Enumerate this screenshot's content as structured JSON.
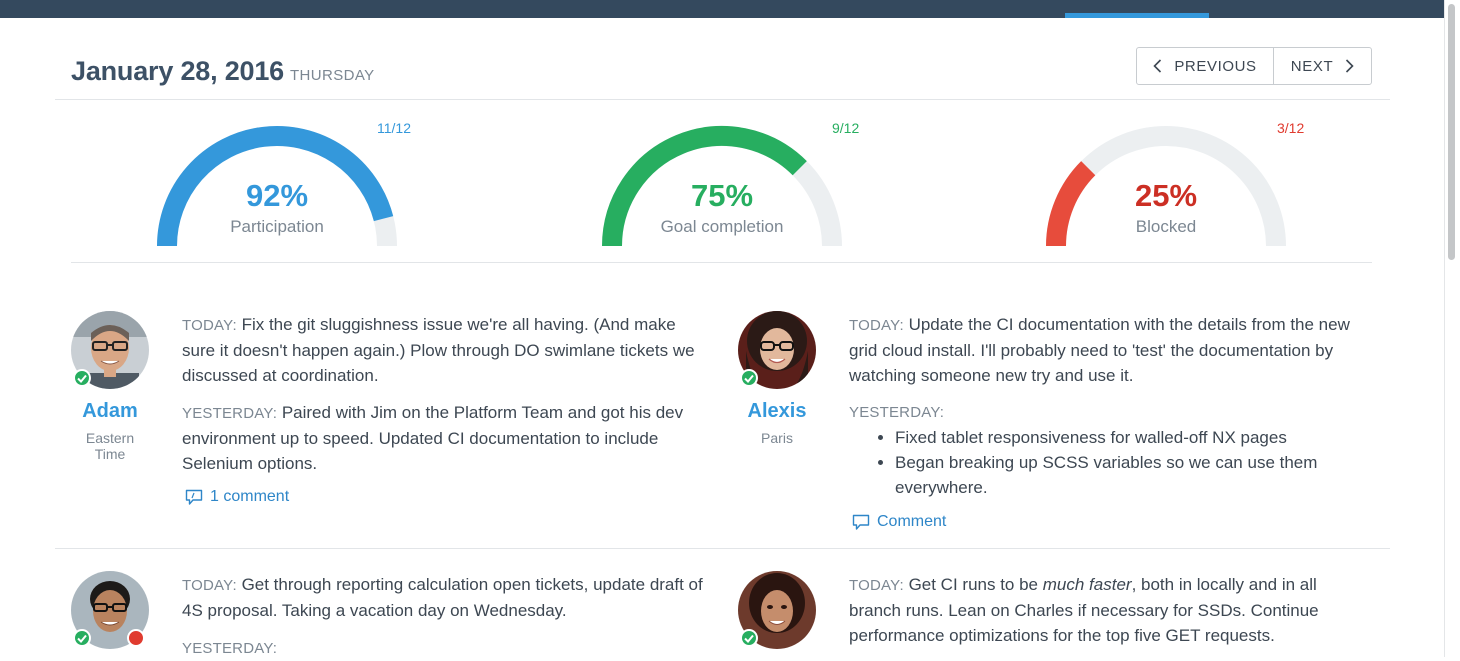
{
  "header": {
    "date": "January 28, 2016",
    "weekday": "THURSDAY",
    "prev_label": "PREVIOUS",
    "next_label": "NEXT"
  },
  "colors": {
    "topbar": "#34495e",
    "accent_blue": "#3498db",
    "green": "#27ae60",
    "red": "#e74c3c",
    "track": "#eceff1"
  },
  "gauges": [
    {
      "percent_text": "92%",
      "value": 0.92,
      "label": "Participation",
      "count": "11/12",
      "color": "#3498db"
    },
    {
      "percent_text": "75%",
      "value": 0.75,
      "label": "Goal completion",
      "count": "9/12",
      "color": "#27ae60"
    },
    {
      "percent_text": "25%",
      "value": 0.25,
      "label": "Blocked",
      "count": "3/12",
      "color": "#e74c3c"
    }
  ],
  "standups": [
    {
      "name": "Adam",
      "timezone_line1": "Eastern",
      "timezone_line2": "Time",
      "status": "ok",
      "today_label": "TODAY:",
      "today": "Fix the git sluggishness issue we're all having. (And make sure it doesn't happen again.) Plow through DO swimlane tickets we discussed at coordination.",
      "yesterday_label": "YESTERDAY:",
      "yesterday": "Paired with Jim on the Platform Team and got his dev environment up to speed. Updated CI documentation to include Selenium options.",
      "comment_label": "1 comment"
    },
    {
      "name": "Alexis",
      "timezone_line1": "Paris",
      "status": "ok",
      "today_label": "TODAY:",
      "today": "Update the CI documentation with the details from the new grid cloud install. I'll probably need to 'test' the documentation by watching someone new try and use it.",
      "yesterday_label": "YESTERDAY:",
      "yesterday_items": [
        "Fixed tablet responsiveness for walled-off NX pages",
        "Began breaking up SCSS variables so we can use them everywhere."
      ],
      "comment_label": "Comment"
    },
    {
      "status": "ok",
      "blocked": true,
      "today_label": "TODAY:",
      "today": "Get through reporting calculation open tickets, update draft of 4S proposal. Taking a vacation day on Wednesday.",
      "yesterday_label": "YESTERDAY:"
    },
    {
      "status": "ok",
      "today_label": "TODAY:",
      "today_before": "Get CI runs to be ",
      "today_emphasis": "much faster",
      "today_after": ", both in locally and in all branch runs. Lean on Charles if necessary for SSDs. Continue performance optimizations for the top five GET requests."
    }
  ]
}
